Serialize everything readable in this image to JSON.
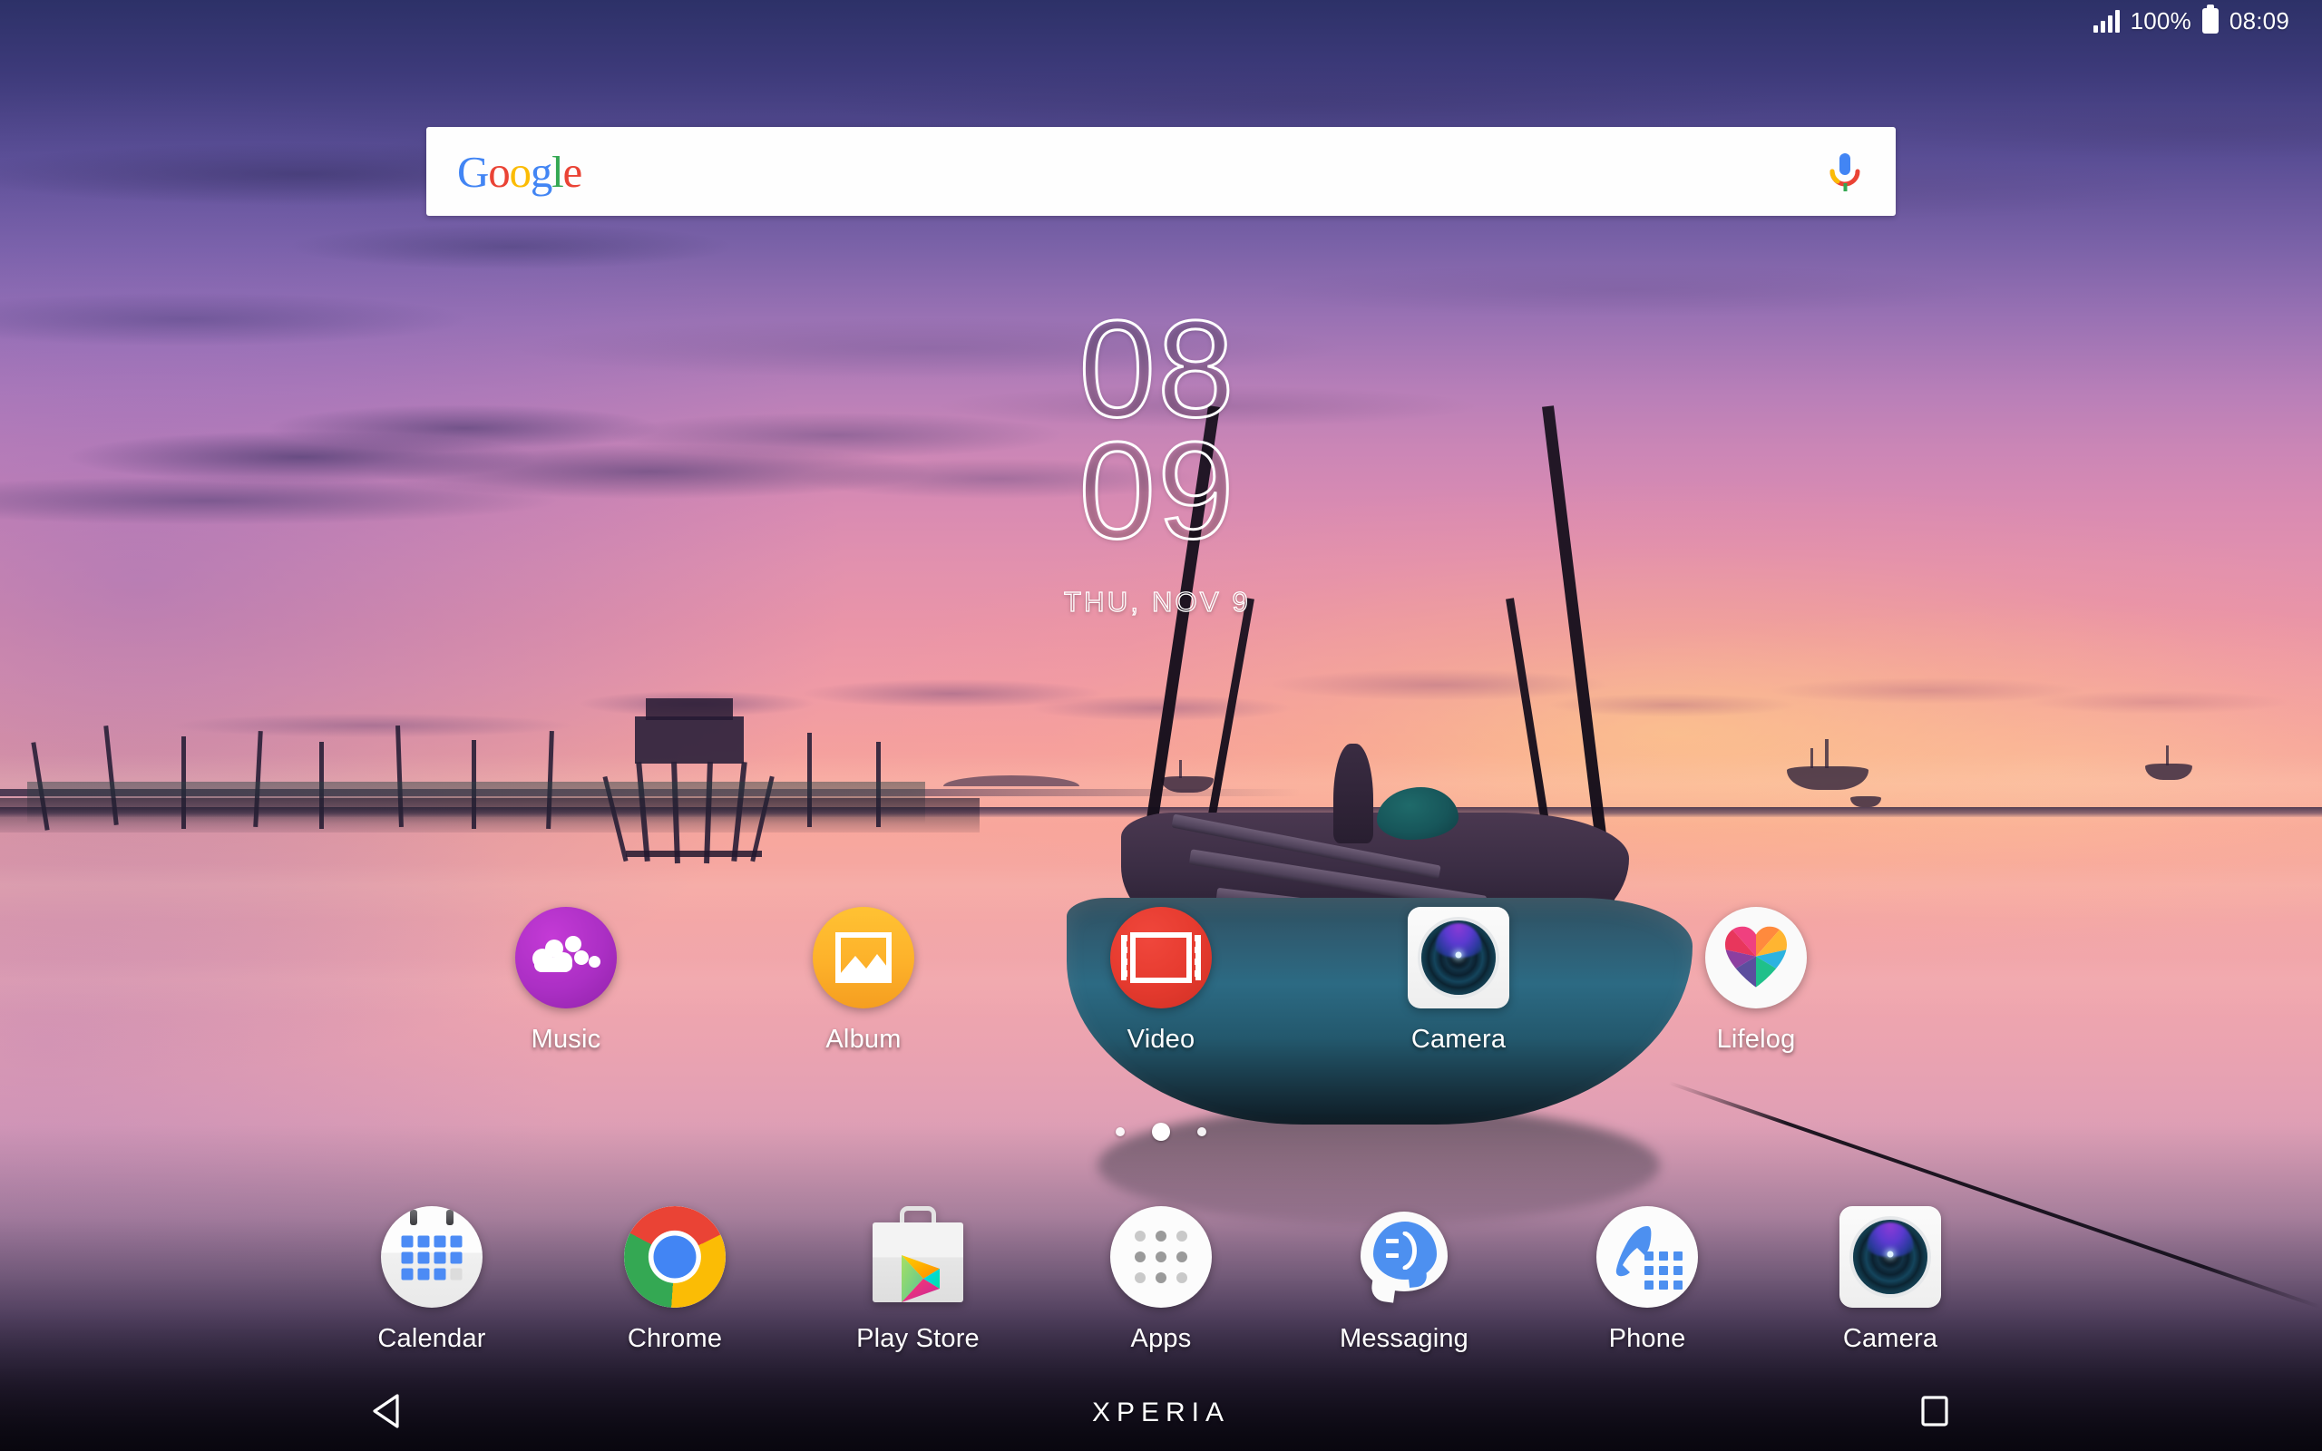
{
  "status_bar": {
    "signal_icon": "signal-bars-icon",
    "battery_percent": "100%",
    "battery_icon": "battery-full-icon",
    "time": "08:09"
  },
  "search": {
    "logo_letters": [
      "G",
      "o",
      "o",
      "g",
      "l",
      "e"
    ],
    "logo_text": "Google",
    "mic_icon": "microphone-icon",
    "placeholder": ""
  },
  "clock_widget": {
    "hours": "08",
    "minutes": "09",
    "date": "THU, NOV 9"
  },
  "home_apps": [
    {
      "label": "Music",
      "icon": "walkman-music-icon",
      "color": "#AB2FC4"
    },
    {
      "label": "Album",
      "icon": "photo-album-icon",
      "color": "#FDB12A"
    },
    {
      "label": "Video",
      "icon": "film-video-icon",
      "color": "#E63B2F"
    },
    {
      "label": "Camera",
      "icon": "camera-lens-icon",
      "color": "#F2F2F2"
    },
    {
      "label": "Lifelog",
      "icon": "lifelog-heart-icon",
      "color": "#FAFAFA"
    }
  ],
  "dock_apps": [
    {
      "label": "Calendar",
      "icon": "calendar-icon",
      "color": "#4C8BF5"
    },
    {
      "label": "Chrome",
      "icon": "chrome-browser-icon",
      "color": "#4285F4"
    },
    {
      "label": "Play Store",
      "icon": "play-store-bag-icon",
      "color": "#EEEEEE"
    },
    {
      "label": "Apps",
      "icon": "app-drawer-grid-icon",
      "color": "#9A9A9A"
    },
    {
      "label": "Messaging",
      "icon": "message-bubble-icon",
      "color": "#4D90F0"
    },
    {
      "label": "Phone",
      "icon": "phone-dialer-icon",
      "color": "#4D90F0"
    },
    {
      "label": "Camera",
      "icon": "camera-lens-icon",
      "color": "#F2F2F2"
    }
  ],
  "page_indicator": {
    "total": 3,
    "active_index": 1
  },
  "nav_bar": {
    "back_icon": "back-triangle-icon",
    "brand": "XPERIA",
    "recents_icon": "recents-square-icon"
  },
  "colors": {
    "google_blue": "#4285F4",
    "google_red": "#EA4335",
    "google_yellow": "#FBBC05",
    "google_green": "#34A853",
    "accent_white": "#FFFFFF"
  }
}
